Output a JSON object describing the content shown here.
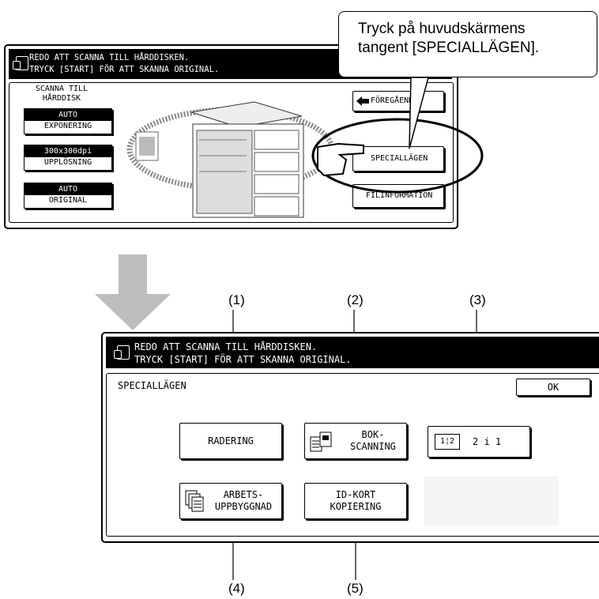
{
  "callout": {
    "line1": "Tryck på huvudskärmens",
    "line2": "tangent [SPECIALLÄGEN]."
  },
  "screen_top": {
    "message_line1": "REDO ATT SCANNA TILL HÅRDDISKEN.",
    "message_line2": "TRYCK [START] FÖR ATT SKANNA ORIGINAL.",
    "mode_label_line1": "SCANNA TILL",
    "mode_label_line2": "HÅRDDISK",
    "exposure": {
      "value": "AUTO",
      "label": "EXPONERING"
    },
    "resolution": {
      "value": "300x300dpi",
      "label": "UPPLÖSNING"
    },
    "original": {
      "value": "AUTO",
      "label": "ORIGINAL"
    },
    "previous_label": "FÖREGÅENDE",
    "special_modes_label": "SPECIALLÄGEN",
    "file_info_label": "FILINFORMATION"
  },
  "screen_bottom": {
    "message_line1": "REDO ATT SCANNA TILL HÅRDDISKEN.",
    "message_line2": "TRYCK [START] FÖR ATT SKANNA ORIGINAL.",
    "title": "SPECIALLÄGEN",
    "ok_label": "OK",
    "buttons": {
      "erase": "RADERING",
      "book_line1": "BOK-",
      "book_line2": "SCANNING",
      "two_in_one": "2 i 1",
      "two_in_one_icon": "1¦2",
      "job_line1": "ARBETS-",
      "job_line2": "UPPBYGGNAD",
      "id_line1": "ID-KORT",
      "id_line2": "KOPIERING"
    }
  },
  "markers": [
    "(1)",
    "(2)",
    "(3)",
    "(4)",
    "(5)"
  ],
  "icons": [
    "panel-icon",
    "arrow-left-icon",
    "pointing-hand-icon",
    "down-arrow-icon",
    "book-scan-icon",
    "job-build-icon",
    "copier-illustration",
    "highlight-ellipse"
  ]
}
